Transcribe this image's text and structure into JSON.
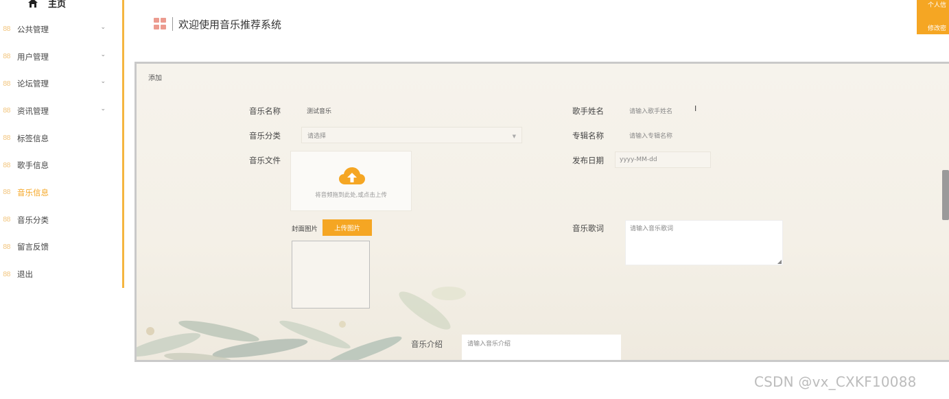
{
  "sidebar": {
    "home_label": "主页",
    "items": [
      {
        "label": "公共管理",
        "has_submenu": true
      },
      {
        "label": "用户管理",
        "has_submenu": true
      },
      {
        "label": "论坛管理",
        "has_submenu": true
      },
      {
        "label": "资讯管理",
        "has_submenu": true
      },
      {
        "label": "标签信息",
        "has_submenu": false
      },
      {
        "label": "歌手信息",
        "has_submenu": false
      },
      {
        "label": "音乐信息",
        "has_submenu": false,
        "active": true
      },
      {
        "label": "音乐分类",
        "has_submenu": false
      },
      {
        "label": "留言反馈",
        "has_submenu": false
      },
      {
        "label": "退出",
        "has_submenu": false
      }
    ]
  },
  "header": {
    "title": "欢迎使用音乐推荐系统",
    "user_menu": [
      "个人信",
      "修改密"
    ]
  },
  "form": {
    "panel_title": "添加",
    "music_name": {
      "label": "音乐名称",
      "value": "测试音乐"
    },
    "singer_name": {
      "label": "歌手姓名",
      "placeholder": "请输入歌手姓名"
    },
    "category": {
      "label": "音乐分类",
      "placeholder": "请选择"
    },
    "album_name": {
      "label": "专辑名称",
      "placeholder": "请输入专辑名称"
    },
    "music_file": {
      "label": "音乐文件",
      "upload_hint": "将音频拖到此处,或点击上传"
    },
    "release_date": {
      "label": "发布日期",
      "placeholder": "yyyy-MM-dd"
    },
    "cover": {
      "label": "封面图片",
      "button": "上传图片"
    },
    "lyrics": {
      "label": "音乐歌词",
      "placeholder": "请输入音乐歌词"
    },
    "intro": {
      "label": "音乐介绍",
      "placeholder": "请输入音乐介绍"
    }
  },
  "watermark": "CSDN @vx_CXKF10088",
  "colors": {
    "accent": "#f5a623",
    "sidebar_border": "#f5b53f",
    "logo": "#ec9b8f"
  }
}
